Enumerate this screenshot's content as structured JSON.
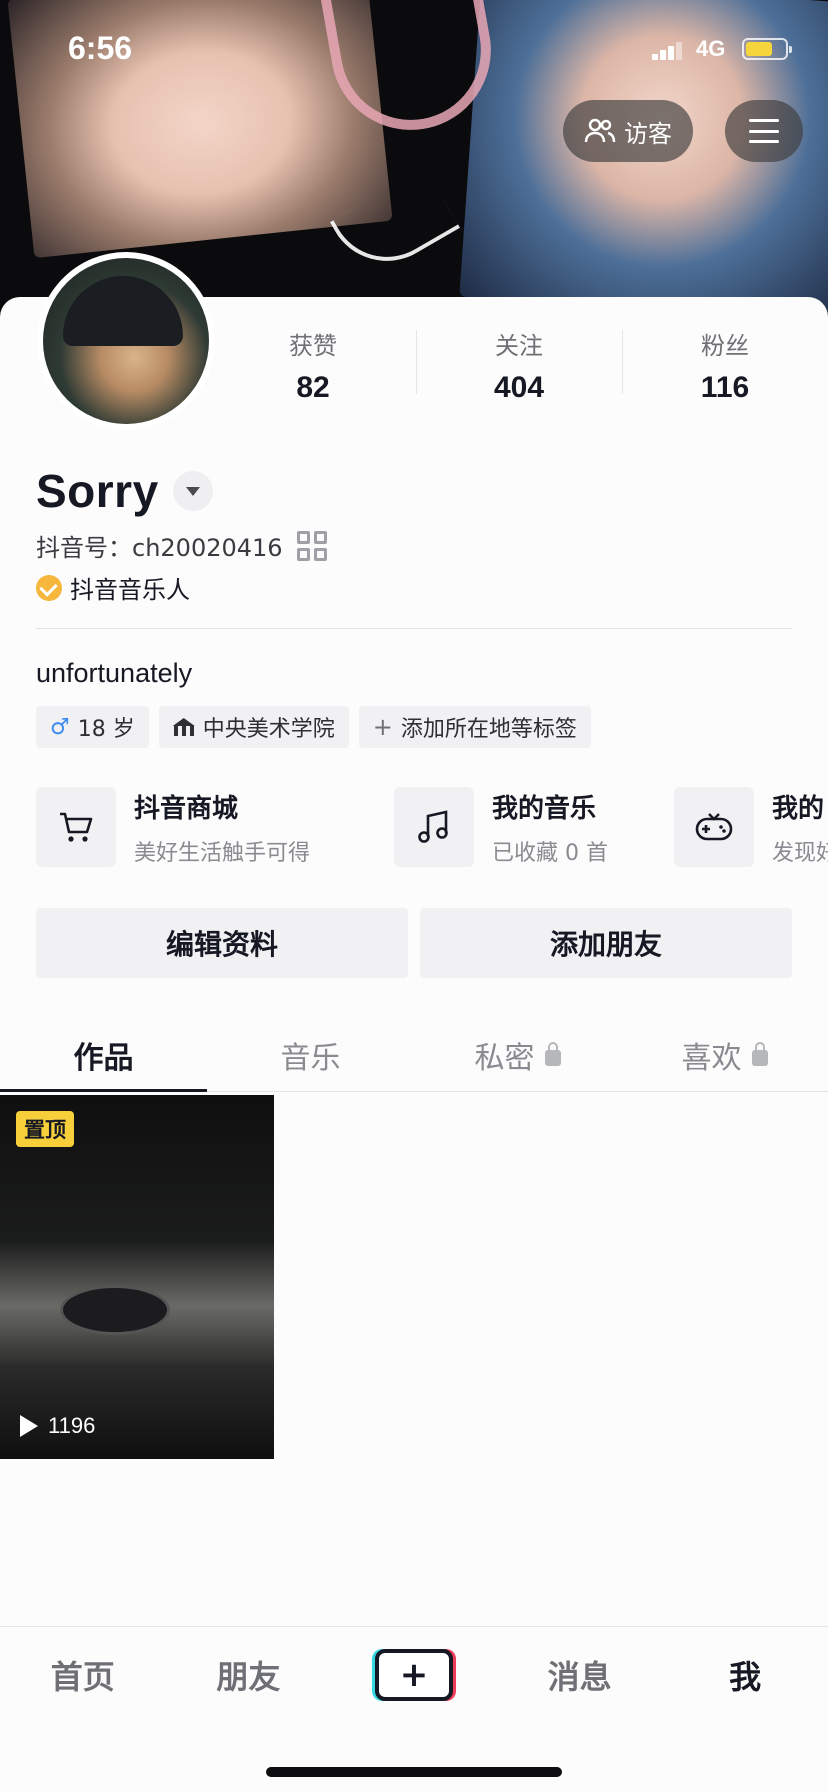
{
  "status_bar": {
    "time": "6:56",
    "network": "4G"
  },
  "header": {
    "visitor_label": "访客"
  },
  "stats": [
    {
      "label": "获赞",
      "value": "82"
    },
    {
      "label": "关注",
      "value": "404"
    },
    {
      "label": "粉丝",
      "value": "116"
    }
  ],
  "profile": {
    "name": "Sorry",
    "douyin_id": "抖音号：ch20020416",
    "verification": "抖音音乐人",
    "bio": "unfortunately"
  },
  "tags": {
    "age": "18 岁",
    "school": "中央美术学院",
    "add_tag": "添加所在地等标签"
  },
  "services": [
    {
      "title": "抖音商城",
      "subtitle": "美好生活触手可得",
      "icon": "cart-icon"
    },
    {
      "title": "我的音乐",
      "subtitle": "已收藏 0 首",
      "icon": "music-note-icon"
    },
    {
      "title": "我的",
      "subtitle": "发现好",
      "icon": "gamepad-icon"
    }
  ],
  "actions": {
    "edit_profile": "编辑资料",
    "add_friend": "添加朋友"
  },
  "tabs": [
    {
      "label": "作品",
      "active": true,
      "locked": false
    },
    {
      "label": "音乐",
      "active": false,
      "locked": false
    },
    {
      "label": "私密",
      "active": false,
      "locked": true
    },
    {
      "label": "喜欢",
      "active": false,
      "locked": true
    }
  ],
  "videos": [
    {
      "pinned_label": "置顶",
      "play_count": "1196"
    }
  ],
  "bottom_nav": {
    "home": "首页",
    "friends": "朋友",
    "create": "+",
    "messages": "消息",
    "me": "我"
  },
  "colors": {
    "pinned_badge": "#f6cf3b",
    "verify_badge": "#f6b73c",
    "male_icon": "#3d8bf2",
    "battery": "#f5d53b"
  }
}
